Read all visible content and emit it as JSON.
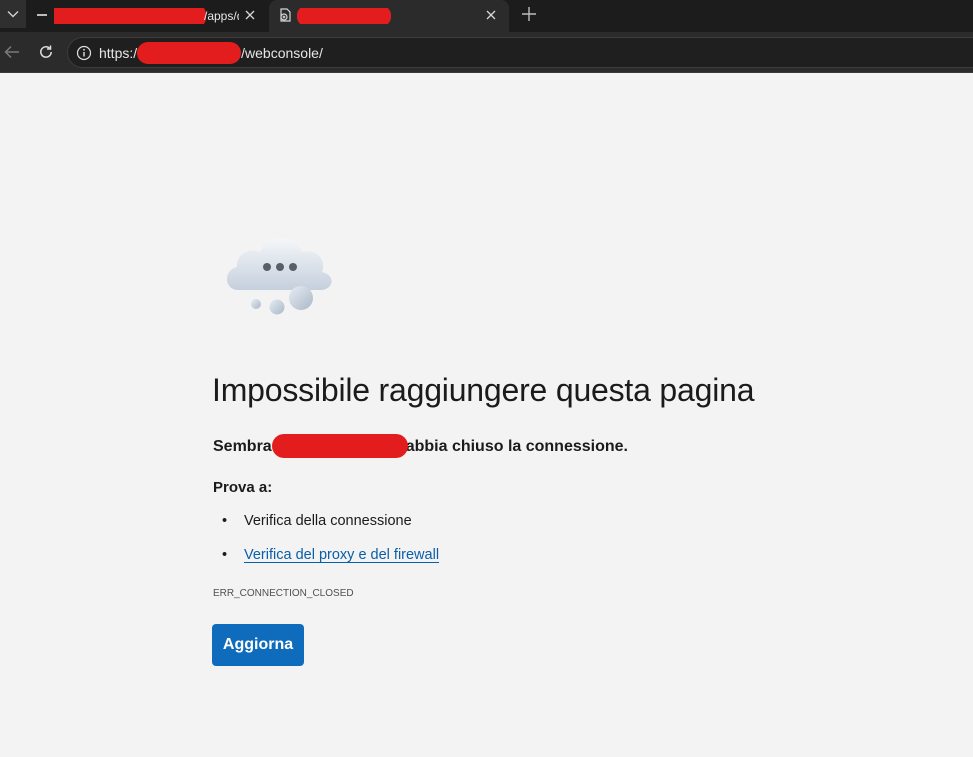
{
  "browser": {
    "tabs": [
      {
        "title": "/apps/dashb",
        "favicon": "site-favicon",
        "close_icon": "close-icon",
        "active": false
      },
      {
        "title": "",
        "favicon": "page-error-icon",
        "close_icon": "close-icon",
        "active": true
      }
    ],
    "address_bar": {
      "url_prefix": "https:/",
      "url_suffix": "/webconsole/",
      "site_info_icon": "info-icon"
    },
    "redaction_color": "#e31d1d"
  },
  "error_page": {
    "illustration": "cloud-disconnected-icon",
    "title": "Impossibile raggiungere questa pagina",
    "subtitle_start": "Sembra",
    "subtitle_end": "abbia chiuso la connessione.",
    "try_heading": "Prova a:",
    "suggestions": [
      {
        "text": "Verifica della connessione",
        "is_link": false
      },
      {
        "text": "Verifica del proxy e del firewall",
        "is_link": true
      }
    ],
    "error_code": "ERR_CONNECTION_CLOSED",
    "reload_label": "Aggiorna",
    "accent_color": "#0f6cbd",
    "link_color": "#0b5ea8"
  }
}
